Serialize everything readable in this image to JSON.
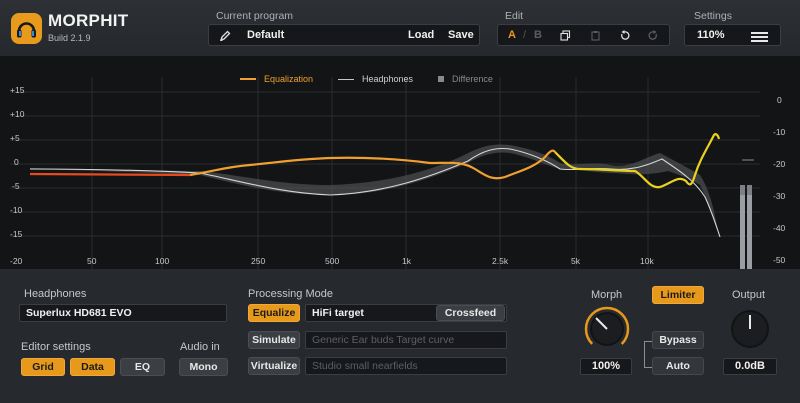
{
  "app": {
    "name": "MORPHIT",
    "build": "Build 2.1.9"
  },
  "header": {
    "program_label": "Current program",
    "program_name": "Default",
    "load_label": "Load",
    "save_label": "Save",
    "edit_label": "Edit",
    "edit_a": "A",
    "edit_sep": "/",
    "edit_b": "B",
    "settings_label": "Settings",
    "zoom": "110%"
  },
  "graph": {
    "legend": [
      {
        "label": "Equalization",
        "color": "#f0a030"
      },
      {
        "label": "Headphones",
        "color": "#c8c8c8"
      },
      {
        "label": "Difference",
        "color": "#8a8a8a"
      }
    ],
    "y_left_ticks": [
      "+15",
      "+10",
      "+5",
      "0",
      "-5",
      "-10",
      "-15",
      "-20"
    ],
    "y_right_ticks": [
      "0",
      "-10",
      "-20",
      "-30",
      "-40",
      "-50"
    ],
    "x_ticks": [
      "50",
      "100",
      "250",
      "500",
      "1k",
      "2.5k",
      "5k",
      "10k"
    ],
    "meter_marker": "—"
  },
  "colors": {
    "accent": "#e7991c",
    "equalization": "#f0a030",
    "eq_red": "#e64a1e",
    "eq_yellow": "#e8d21e"
  },
  "panel": {
    "headphones_label": "Headphones",
    "headphones_value": "Superlux HD681 EVO",
    "editor_label": "Editor settings",
    "editor_buttons": [
      "Grid",
      "Data",
      "EQ"
    ],
    "audio_in_label": "Audio in",
    "audio_in_value": "Mono",
    "processing_label": "Processing Mode",
    "equalize_btn": "Equalize",
    "equalize_target": "HiFi target",
    "crossfeed_btn": "Crossfeed",
    "simulate_btn": "Simulate",
    "simulate_target": "Generic Ear buds Target curve",
    "virtualize_btn": "Virtualize",
    "virtualize_target": "Studio small nearfields",
    "morph_label": "Morph",
    "morph_value": "100%",
    "limiter_btn": "Limiter",
    "bypass_btn": "Bypass",
    "auto_btn": "Auto",
    "output_label": "Output",
    "output_value": "0.0dB"
  }
}
